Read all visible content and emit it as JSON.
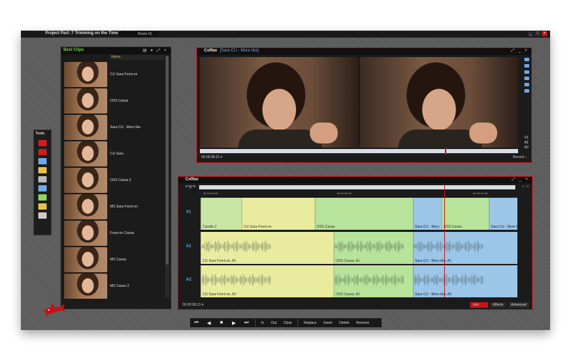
{
  "window": {
    "title": "Project Part: 7 Trimming on the Timeline",
    "room": "Room #1",
    "min_label": "_",
    "max_label": "□",
    "close_label": "×"
  },
  "tools": {
    "label": "Tools",
    "items": [
      {
        "icon": "record-icon",
        "color": "#d01c1c"
      },
      {
        "icon": "red-camera-icon",
        "color": "#d01c1c"
      },
      {
        "icon": "grid-icon",
        "color": "#6fa9e6"
      },
      {
        "icon": "folder-icon",
        "color": "#e8c14a"
      },
      {
        "icon": "keyboard-icon",
        "color": "#bbbbbb"
      },
      {
        "icon": "monitor-icon",
        "color": "#6fa9e6"
      },
      {
        "icon": "tv-icon",
        "color": "#8fd35a"
      },
      {
        "icon": "timeline-icon",
        "color": "#e8c14a"
      },
      {
        "icon": "people-icon",
        "color": "#cccccc"
      }
    ]
  },
  "bins": {
    "title": "Best Clips",
    "column_header": "Name",
    "clips": [
      {
        "name": "CU Sara Front-on"
      },
      {
        "name": "OSS Cassa"
      },
      {
        "name": "Sara CU - More like"
      },
      {
        "name": "CU Sara"
      },
      {
        "name": "OSS Cassa 2"
      },
      {
        "name": "MS Sara Front-on"
      },
      {
        "name": "Front-on Cassa"
      },
      {
        "name": "MS Cassa"
      },
      {
        "name": "MS Cassa 2"
      }
    ]
  },
  "viewer": {
    "title": "Coffee",
    "subtitle": "[Sara CU - More like]",
    "timecode": "00:00:08.21",
    "record_label": "Record",
    "tracks": [
      "V1",
      "A1",
      "A2"
    ],
    "playhead_fraction": 0.77
  },
  "timeline": {
    "title": "Coffee",
    "ruler_marks": [
      "00:00:00.00",
      "00:00:05.00",
      "00:00:10.00"
    ],
    "footer_timecode": "00:00:08.21",
    "buttons": {
      "red": "Join",
      "effects": "Effects",
      "advanced": "Advanced"
    },
    "playhead_fraction": 0.77,
    "tracks": [
      {
        "label": "V1",
        "clips": [
          {
            "name": "Candle 2",
            "start": 0.0,
            "end": 0.13,
            "color": "#c7e6a4"
          },
          {
            "name": "CU Sara Front-on",
            "start": 0.13,
            "end": 0.36,
            "color": "#e9eb9f"
          },
          {
            "name": "OSS Cassa",
            "start": 0.36,
            "end": 0.67,
            "color": "#b8e39a"
          },
          {
            "name": "Sara CU - More",
            "start": 0.67,
            "end": 0.76,
            "color": "#9cc6e8"
          },
          {
            "name": "OSS Cassa",
            "start": 0.76,
            "end": 0.91,
            "color": "#b8e39a"
          },
          {
            "name": "Sara CU - More li",
            "start": 0.91,
            "end": 1.0,
            "color": "#9cc6e8"
          }
        ]
      },
      {
        "label": "A1",
        "clips": [
          {
            "name": "CU Sara Front-on, A1",
            "start": 0.0,
            "end": 0.42,
            "color": "#e9eb9f"
          },
          {
            "name": "OSS Cassa, A1",
            "start": 0.42,
            "end": 0.67,
            "color": "#b8e39a"
          },
          {
            "name": "Sara CU - More like, A1",
            "start": 0.67,
            "end": 1.0,
            "color": "#9cc6e8"
          }
        ]
      },
      {
        "label": "A2",
        "clips": [
          {
            "name": "CU Sara Front-on, A2",
            "start": 0.0,
            "end": 0.42,
            "color": "#e9eb9f"
          },
          {
            "name": "OSS Cassa, A2",
            "start": 0.42,
            "end": 0.67,
            "color": "#b8e39a"
          },
          {
            "name": "Sara CU - More like, A2",
            "start": 0.67,
            "end": 1.0,
            "color": "#9cc6e8"
          }
        ]
      }
    ]
  },
  "toolbar": {
    "nav": [
      "⏮",
      "◀",
      "■",
      "▶",
      "⏭"
    ],
    "in": "In",
    "out": "Out",
    "clear": "Clear",
    "replace": "Replace",
    "insert": "Insert",
    "delete": "Delete",
    "remove": "Remove"
  }
}
